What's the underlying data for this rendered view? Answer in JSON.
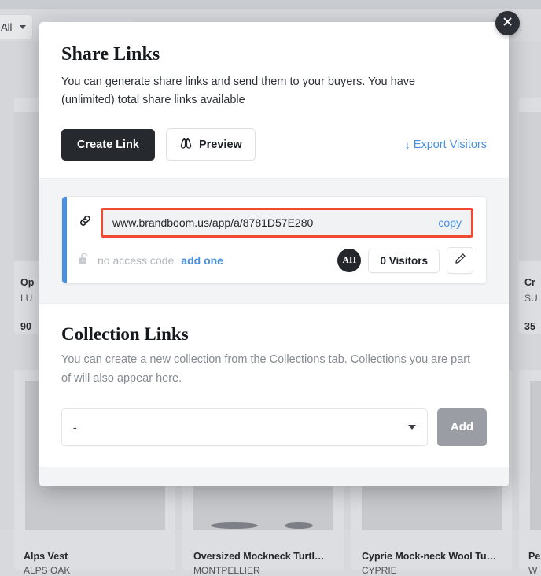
{
  "background": {
    "filter": {
      "label": "All",
      "caret_icon": "chevron-down-icon"
    },
    "cards_side": [
      {
        "title": "Op",
        "sku": "LU",
        "price": "90"
      },
      {
        "title": "Cr",
        "sku": "SU",
        "price": "35"
      }
    ],
    "cards_bottom": [
      {
        "title": "Alps Vest",
        "sku": "ALPS OAK"
      },
      {
        "title": "Oversized Mockneck Turtl…",
        "sku": "MONTPELLIER"
      },
      {
        "title": "Cyprie Mock-neck Wool Tu…",
        "sku": "CYPRIE"
      },
      {
        "title": "Pe",
        "sku": "W"
      }
    ]
  },
  "modal": {
    "close_icon": "close-icon",
    "share": {
      "title": "Share Links",
      "description": "You can generate share links and send them to your buyers. You have (unlimited) total share links available",
      "create_link_label": "Create Link",
      "preview_label": "Preview",
      "preview_icon": "binoculars-icon",
      "export_label": "Export Visitors",
      "export_arrow": "↓",
      "export_color": "#4a90e2"
    },
    "link_card": {
      "accent_color": "#4a90e2",
      "highlight_color": "#f04a32",
      "chain_icon": "link-icon",
      "url": "www.brandboom.us/app/a/8781D57E280",
      "copy_label": "copy",
      "lock_icon": "unlocked-padlock-icon",
      "access_code_text": "no access code",
      "add_one_label": "add one",
      "avatar_initials": "AH",
      "visitors_label": "0 Visitors",
      "edit_icon": "pencil-icon"
    },
    "collection": {
      "title": "Collection Links",
      "description": "You can create a new collection from the Collections tab. Collections you are part of will also appear here.",
      "select_value": "-",
      "select_caret_icon": "chevron-down-icon",
      "add_label": "Add"
    }
  }
}
